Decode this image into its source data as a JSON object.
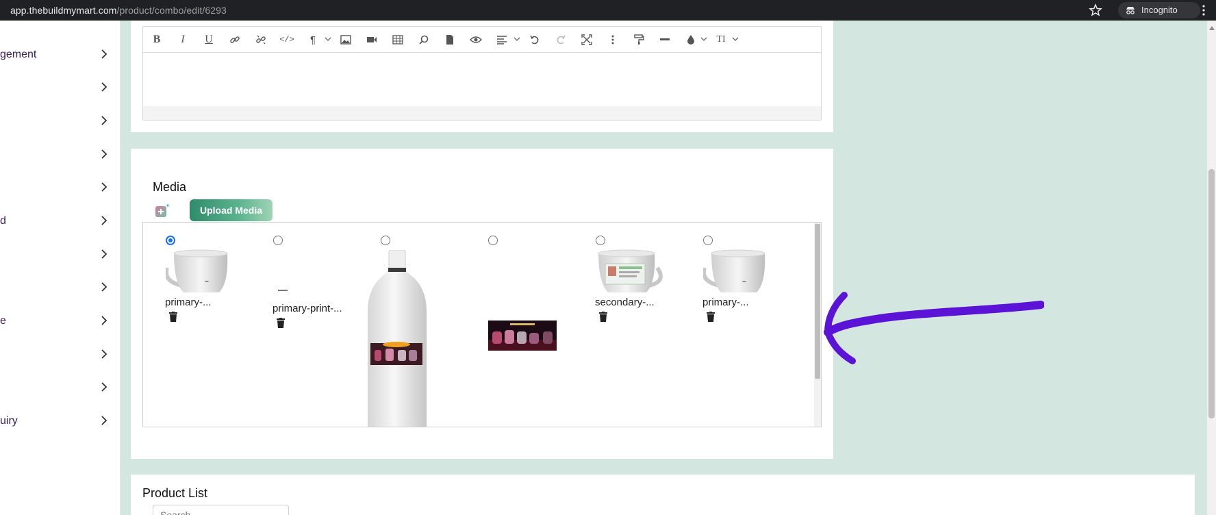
{
  "browser": {
    "url_host": "app.thebuildmymart.com",
    "url_path": "/product/combo/edit/6293",
    "incognito_label": "Incognito"
  },
  "sidebar": {
    "items": [
      {
        "label": "gement"
      },
      {
        "label": ""
      },
      {
        "label": ""
      },
      {
        "label": ""
      },
      {
        "label": ""
      },
      {
        "label": "d"
      },
      {
        "label": ""
      },
      {
        "label": ""
      },
      {
        "label": "e"
      },
      {
        "label": ""
      },
      {
        "label": ""
      },
      {
        "label": "uiry"
      }
    ]
  },
  "editor": {
    "toolbar_icons": [
      "bold-icon",
      "italic-icon",
      "underline-icon",
      "link-icon",
      "unlink-icon",
      "code-view-icon",
      "paragraph-icon",
      "image-icon",
      "video-icon",
      "table-icon",
      "find-icon",
      "document-icon",
      "preview-icon",
      "align-icon",
      "undo-icon",
      "redo-icon",
      "fullscreen-icon",
      "more-icon",
      "format-painter-icon",
      "horizontal-rule-icon",
      "text-color-icon",
      "text-size-icon"
    ]
  },
  "media": {
    "title": "Media",
    "upload_button": "Upload Media",
    "items": [
      {
        "name": "primary-...",
        "selected": true,
        "thumb": "mug"
      },
      {
        "name": "primary-print-...",
        "selected": false,
        "thumb": "tiny-label"
      },
      {
        "name": "",
        "selected": false,
        "thumb": "bottle"
      },
      {
        "name": "",
        "selected": false,
        "thumb": "banner"
      },
      {
        "name": "secondary-...",
        "selected": false,
        "thumb": "mug-print"
      },
      {
        "name": "primary-...",
        "selected": false,
        "thumb": "mug"
      }
    ]
  },
  "product_list": {
    "title": "Product List",
    "search_placeholder": "Search"
  },
  "colors": {
    "accent_green": "#2f8b6a",
    "arrow_purple": "#5b14d6",
    "background": "#d4e6e0"
  }
}
